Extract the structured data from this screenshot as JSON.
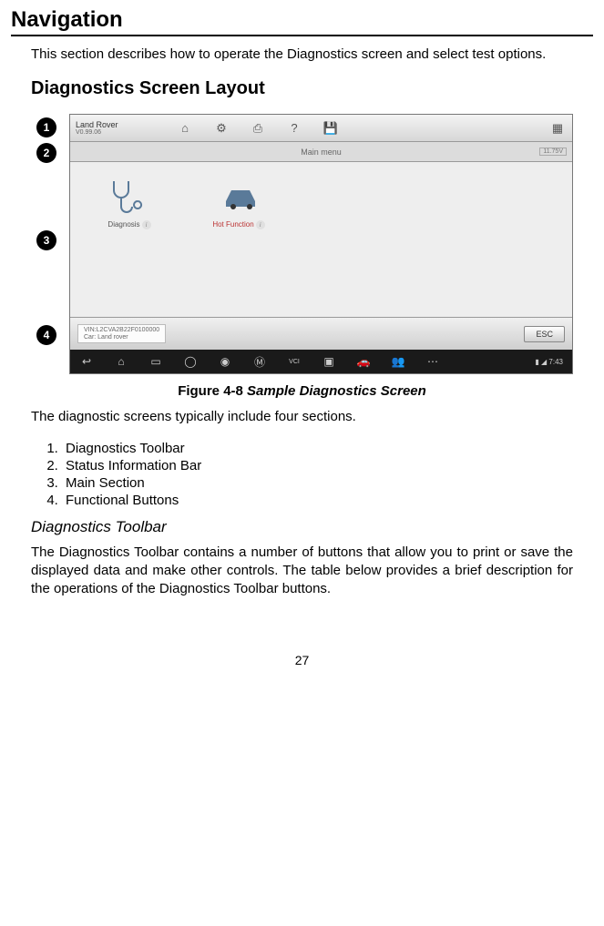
{
  "headings": {
    "h1": "Navigation",
    "h2": "Diagnostics Screen Layout",
    "h3": "Diagnostics Toolbar"
  },
  "paras": {
    "intro": "This section describes how to operate the Diagnostics screen and select test options.",
    "sections_intro": "The diagnostic screens typically include four sections.",
    "toolbar_desc": "The Diagnostics Toolbar contains a number of buttons that allow you to print or save the displayed data and make other controls. The table below provides a brief description for the operations of the Diagnostics Toolbar buttons."
  },
  "caption": {
    "prefix": "Figure 4-8 ",
    "title": "Sample Diagnostics Screen"
  },
  "list": {
    "items": [
      "Diagnostics Toolbar",
      "Status Information Bar",
      "Main Section",
      "Functional Buttons"
    ]
  },
  "callouts": [
    "1",
    "2",
    "3",
    "4"
  ],
  "screenshot": {
    "brand": "Land Rover",
    "version": "V0.99.06",
    "toolbar_icons": [
      "home-icon",
      "gear-icon",
      "print-icon",
      "question-icon",
      "save-icon",
      "close-icon"
    ],
    "status_title": "Main menu",
    "status_right": "11.75V",
    "main_items": [
      {
        "label": "Diagnosis",
        "hot": false
      },
      {
        "label": "Hot Function",
        "hot": true
      }
    ],
    "vin_line1": "VIN:L2CVA2B22F0100000",
    "vin_line2": "Car: Land rover",
    "esc": "ESC",
    "android_icons": [
      "back-icon",
      "home-icon",
      "recent-icon",
      "browser-icon",
      "camera-icon",
      "m-icon",
      "vci-icon",
      "folder-icon",
      "car-icon",
      "users-icon",
      "more-icon"
    ],
    "android_time": "7:43"
  },
  "page_number": "27"
}
